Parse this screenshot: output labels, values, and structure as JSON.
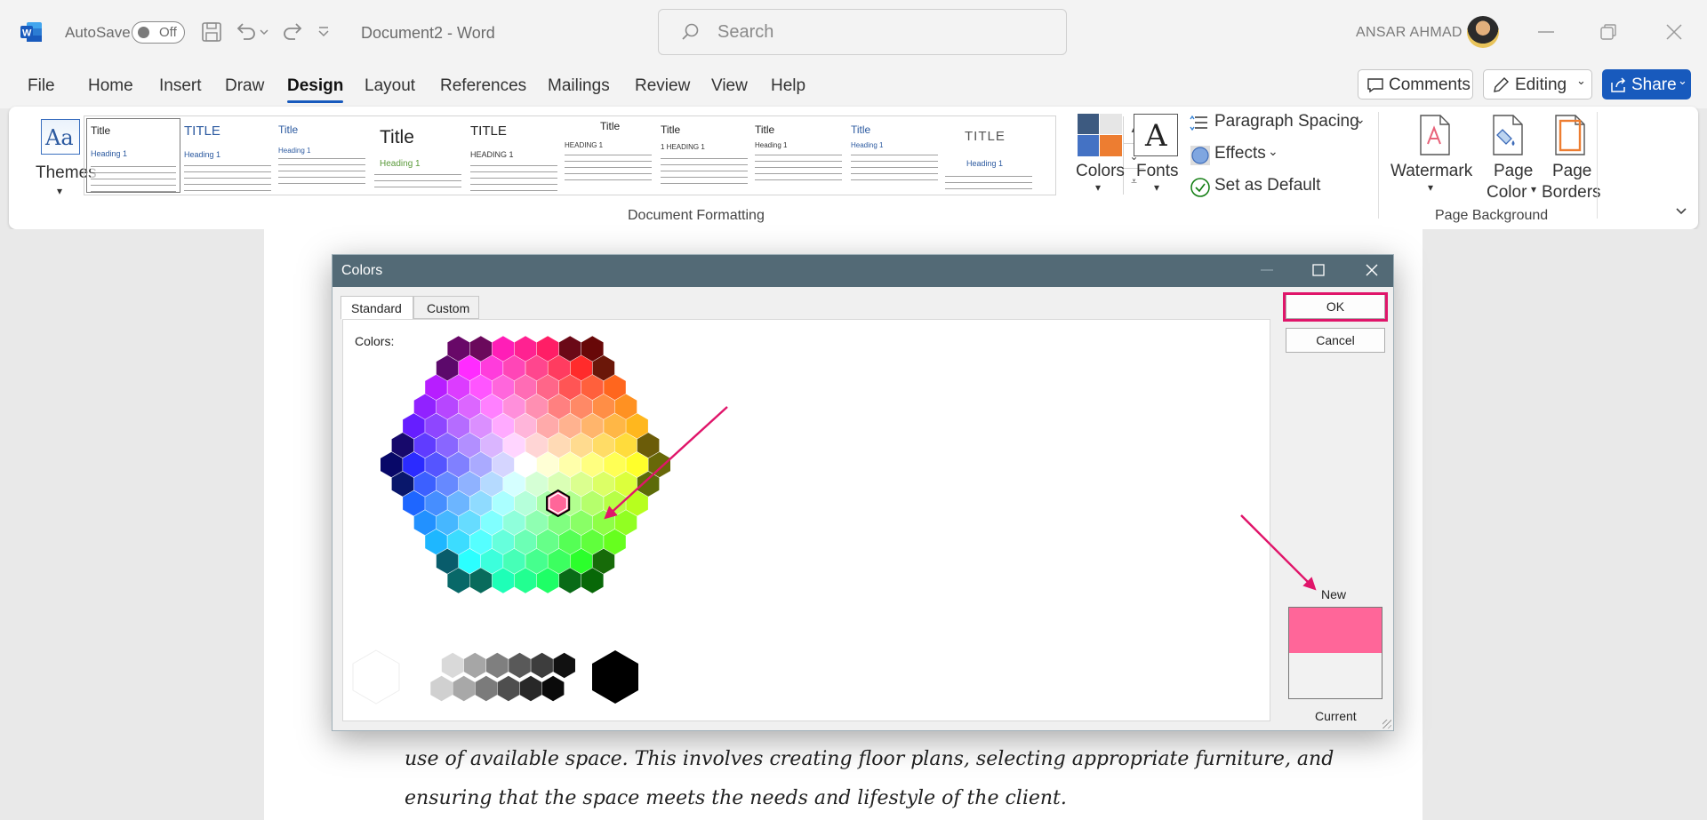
{
  "titlebar": {
    "autosave_label": "AutoSave",
    "autosave_state": "Off",
    "document_title": "Document2  -  Word",
    "search_placeholder": "Search",
    "user_name": "ANSAR AHMAD"
  },
  "menu": {
    "tabs": [
      "File",
      "Home",
      "Insert",
      "Draw",
      "Design",
      "Layout",
      "References",
      "Mailings",
      "Review",
      "View",
      "Help"
    ],
    "active_tab": "Design",
    "comments_label": "Comments",
    "editing_label": "Editing",
    "share_label": "Share"
  },
  "ribbon": {
    "themes_label": "Themes",
    "gallery": [
      {
        "title": "Title",
        "heading": "Heading 1"
      },
      {
        "title": "TITLE",
        "heading": "Heading 1"
      },
      {
        "title": "Title",
        "heading": "Heading 1"
      },
      {
        "title": "Title",
        "heading": "Heading 1"
      },
      {
        "title": "TITLE",
        "heading": "HEADING 1"
      },
      {
        "title": "Title",
        "heading": "HEADING 1"
      },
      {
        "title": "Title",
        "heading": "1  HEADING 1"
      },
      {
        "title": "Title",
        "heading": "Heading 1"
      },
      {
        "title": "Title",
        "heading": "Heading 1"
      },
      {
        "title": "TITLE",
        "heading": "Heading 1"
      }
    ],
    "colors_label": "Colors",
    "fonts_label": "Fonts",
    "paragraph_spacing_label": "Paragraph Spacing",
    "effects_label": "Effects",
    "set_default_label": "Set as Default",
    "document_formatting_label": "Document Formatting",
    "watermark_label": "Watermark",
    "page_color_line1": "Page",
    "page_color_line2": "Color",
    "page_borders_line1": "Page",
    "page_borders_line2": "Borders",
    "page_background_label": "Page Background"
  },
  "document": {
    "lines": [
      "use of available space. This involves creating floor plans, selecting appropriate furniture, and",
      "ensuring that the space meets the needs and lifestyle of the client."
    ]
  },
  "dialog": {
    "title": "Colors",
    "tabs": [
      "Standard",
      "Custom"
    ],
    "active_tab": "Standard",
    "colors_label": "Colors:",
    "ok_label": "OK",
    "cancel_label": "Cancel",
    "new_label": "New",
    "current_label": "Current",
    "new_color": "#ff6699",
    "current_color": "#f2f2f2",
    "selected_color": "#ff6699"
  },
  "colors": {
    "annotation_accent": "#e0156a",
    "word_blue": "#185abd",
    "dialog_titlebar": "#536a76"
  }
}
